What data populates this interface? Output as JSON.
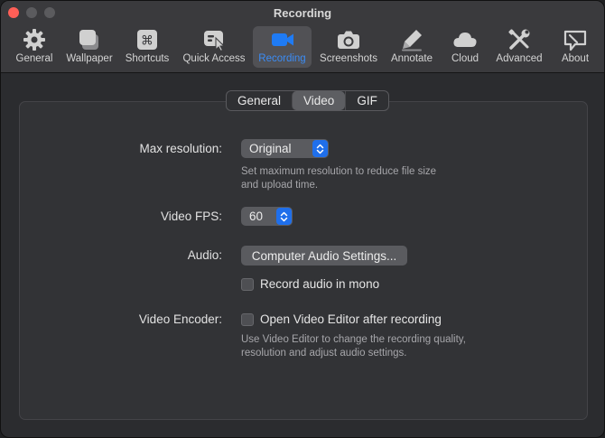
{
  "window": {
    "title": "Recording"
  },
  "toolbar": {
    "items": [
      {
        "label": "General",
        "icon": "gear-icon"
      },
      {
        "label": "Wallpaper",
        "icon": "wallpaper-icon"
      },
      {
        "label": "Shortcuts",
        "icon": "command-key-icon"
      },
      {
        "label": "Quick Access",
        "icon": "quick-access-icon"
      },
      {
        "label": "Recording",
        "icon": "video-camera-icon",
        "active": true
      },
      {
        "label": "Screenshots",
        "icon": "camera-icon"
      },
      {
        "label": "Annotate",
        "icon": "pencil-icon"
      },
      {
        "label": "Cloud",
        "icon": "cloud-icon"
      },
      {
        "label": "Advanced",
        "icon": "tools-icon"
      },
      {
        "label": "About",
        "icon": "about-icon"
      }
    ],
    "active_color": "#3b8cf5"
  },
  "tabs": [
    "General",
    "Video",
    "GIF"
  ],
  "active_tab": "Video",
  "settings": {
    "max_resolution": {
      "label": "Max resolution:",
      "value": "Original",
      "hint_line1": "Set maximum resolution to reduce file size",
      "hint_line2": "and upload time."
    },
    "video_fps": {
      "label": "Video FPS:",
      "value": "60"
    },
    "audio": {
      "label": "Audio:",
      "button": "Computer Audio Settings...",
      "mono_checkbox": "Record audio in mono",
      "mono_checked": false
    },
    "video_encoder": {
      "label": "Video Encoder:",
      "editor_checkbox": "Open Video Editor after recording",
      "editor_checked": false,
      "hint_line1": "Use Video Editor to change the recording quality,",
      "hint_line2": "resolution and adjust audio settings."
    }
  }
}
